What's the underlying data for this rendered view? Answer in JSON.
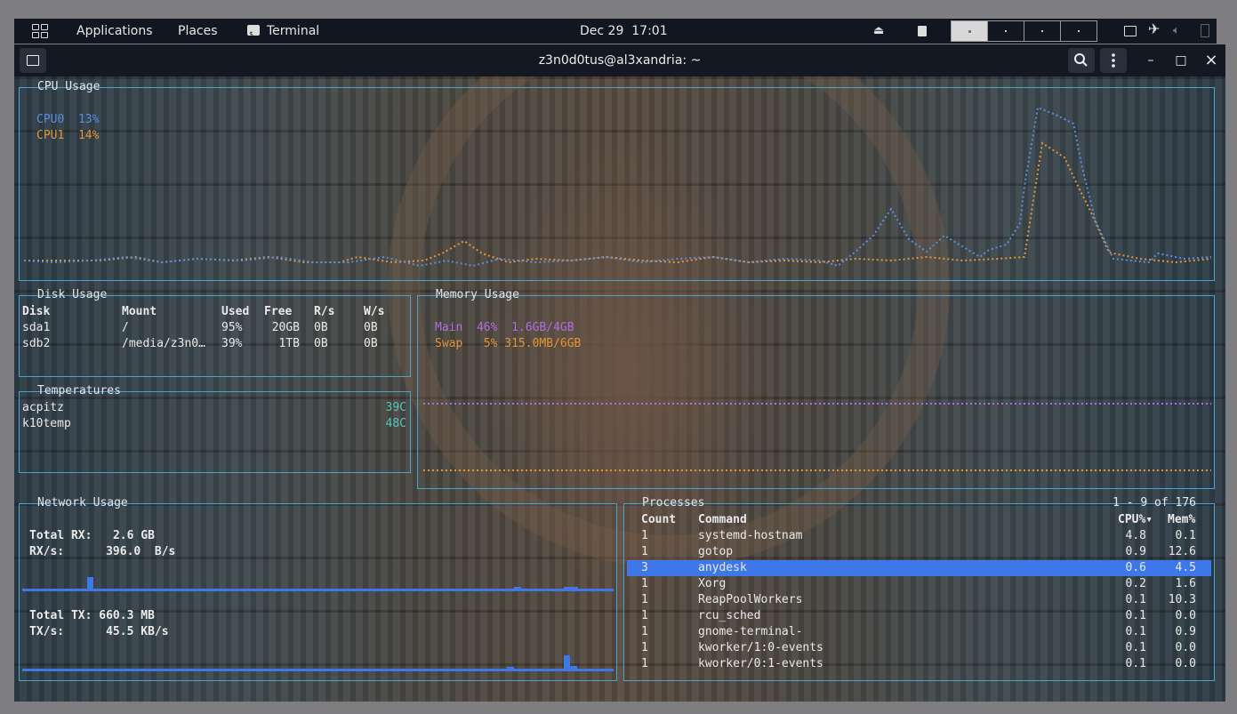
{
  "topbar": {
    "applications": "Applications",
    "places": "Places",
    "terminal": "Terminal",
    "date": "Dec 29",
    "time": "17:01",
    "icons": [
      "grid-icon",
      "terminal-icon",
      "eject-icon",
      "document-icon",
      "screen-icon",
      "airplane-icon",
      "volume-icon",
      "battery-icon"
    ]
  },
  "window": {
    "title": "z3n0d0tus@al3xandria: ~",
    "minimize": "–",
    "maximize": "□",
    "close": "×"
  },
  "cpu": {
    "title": "CPU Usage",
    "cores": [
      {
        "label": "CPU0",
        "value": "13%",
        "color": "#5a8fe0"
      },
      {
        "label": "CPU1",
        "value": "14%",
        "color": "#e2963a"
      }
    ]
  },
  "disk": {
    "title": "Disk Usage",
    "headers": [
      "Disk",
      "Mount",
      "Used",
      "Free",
      "R/s",
      "W/s"
    ],
    "rows": [
      [
        "sda1",
        "/",
        "95%",
        "20GB",
        "0B",
        "0B"
      ],
      [
        "sdb2",
        "/media/z3n0…",
        "39%",
        "1TB",
        "0B",
        "0B"
      ]
    ]
  },
  "temps": {
    "title": "Temperatures",
    "rows": [
      {
        "name": "acpitz",
        "value": "39C"
      },
      {
        "name": "k10temp",
        "value": "48C"
      }
    ]
  },
  "memory": {
    "title": "Memory Usage",
    "main": {
      "label": "Main",
      "percent": "46%",
      "amount": "1.6GB/4GB",
      "color": "#b06ee0"
    },
    "swap": {
      "label": "Swap",
      "percent": "5%",
      "amount": "315.0MB/6GB",
      "color": "#e2963a"
    }
  },
  "network": {
    "title": "Network Usage",
    "total_rx_label": "Total RX:",
    "total_rx": "2.6 GB",
    "rx_s_label": "RX/s:",
    "rx_s": "396.0  B/s",
    "total_tx_label": "Total TX:",
    "total_tx": "660.3 MB",
    "tx_s_label": "TX/s:",
    "tx_s": "45.5 KB/s"
  },
  "processes": {
    "title": "Processes",
    "range": "1 - 9 of 176",
    "headers": [
      "Count",
      "Command",
      "CPU%▾",
      "Mem%"
    ],
    "selected_index": 2,
    "rows": [
      [
        "1",
        "systemd-hostnam",
        "4.8",
        "0.1"
      ],
      [
        "1",
        "gotop",
        "0.9",
        "12.6"
      ],
      [
        "3",
        "anydesk",
        "0.6",
        "4.5"
      ],
      [
        "1",
        "Xorg",
        "0.2",
        "1.6"
      ],
      [
        "1",
        "ReapPoolWorkers",
        "0.1",
        "10.3"
      ],
      [
        "1",
        "rcu_sched",
        "0.1",
        "0.0"
      ],
      [
        "1",
        "gnome-terminal-",
        "0.1",
        "0.9"
      ],
      [
        "1",
        "kworker/1:0-events",
        "0.1",
        "0.0"
      ],
      [
        "1",
        "kworker/0:1-events",
        "0.1",
        "0.0"
      ]
    ]
  }
}
